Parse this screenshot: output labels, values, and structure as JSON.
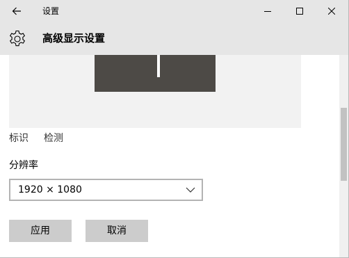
{
  "titlebar": {
    "app_title": "设置",
    "back_icon": "arrow-left-icon",
    "minimize_icon": "minimize-icon",
    "maximize_icon": "maximize-icon",
    "close_icon": "close-icon"
  },
  "header": {
    "icon": "gear-icon",
    "title": "高级显示设置"
  },
  "display_preview": {
    "links": {
      "identify": "标识",
      "detect": "检测"
    }
  },
  "resolution": {
    "label": "分辨率",
    "selected": "1920 × 1080",
    "icon": "chevron-down-icon"
  },
  "actions": {
    "apply": "应用",
    "cancel": "取消"
  },
  "colors": {
    "titlebar_bg": "#e6e6e6",
    "monitor": "#4d4a46",
    "button_bg": "#cccccc",
    "preview_bg": "#f2f2f2"
  }
}
